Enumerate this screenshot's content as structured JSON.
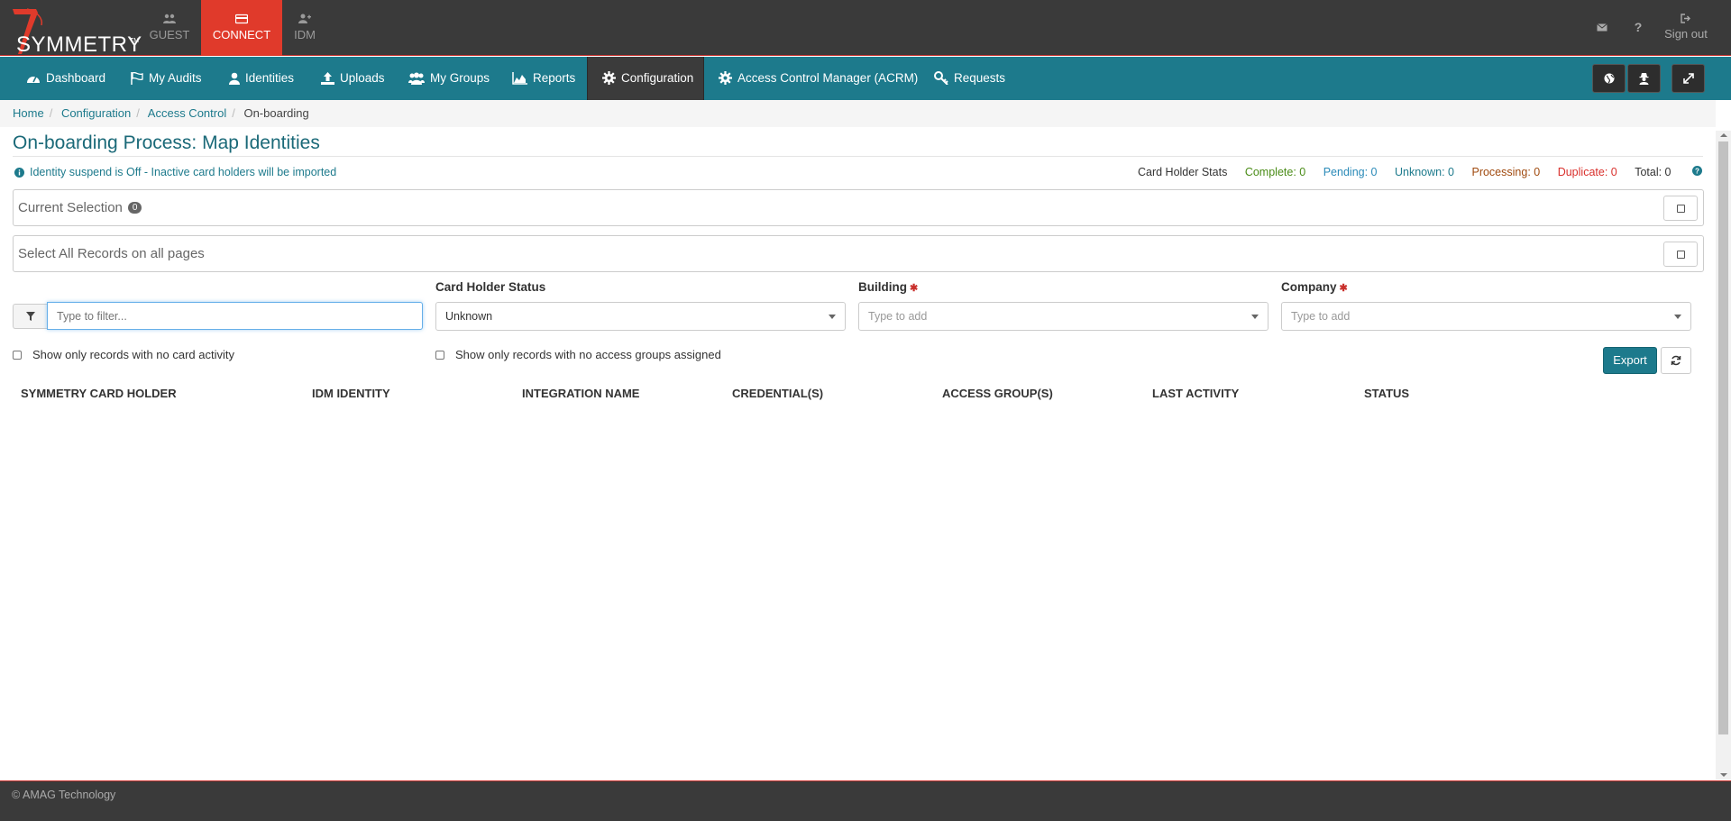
{
  "header": {
    "logo_text": "SYMMETRY",
    "logo_tm": "TM",
    "app_tabs": [
      {
        "label": "GUEST",
        "icon": "users-icon"
      },
      {
        "label": "CONNECT",
        "icon": "card-icon",
        "active": true
      },
      {
        "label": "IDM",
        "icon": "user-add-icon"
      }
    ],
    "right": {
      "mail_icon": "envelope-icon",
      "help_icon": "question-icon",
      "signout_label": "Sign out"
    },
    "colors": {
      "bar": "#3a3a3a",
      "active_tab": "#e03a2b",
      "accent": "#1d7a8c"
    }
  },
  "nav": {
    "items": [
      {
        "label": "Dashboard",
        "icon": "dashboard-icon"
      },
      {
        "label": "My Audits",
        "icon": "flag-icon"
      },
      {
        "label": "Identities",
        "icon": "user-icon"
      },
      {
        "label": "Uploads",
        "icon": "upload-icon"
      },
      {
        "label": "My Groups",
        "icon": "group-icon"
      },
      {
        "label": "Reports",
        "icon": "area-chart-icon"
      },
      {
        "label": "Configuration",
        "icon": "gear-icon",
        "active": true
      },
      {
        "label": "Access Control Manager (ACRM)",
        "icon": "gear-icon"
      },
      {
        "label": "Requests",
        "icon": "key-icon"
      }
    ],
    "right_buttons": [
      "globe-icon",
      "user-secret-icon",
      "expand-icon"
    ]
  },
  "breadcrumb": {
    "items": [
      "Home",
      "Configuration",
      "Access Control"
    ],
    "current": "On-boarding"
  },
  "page": {
    "title": "On-boarding Process: Map Identities",
    "info": "Identity suspend is Off - Inactive card holders will be imported",
    "stats": {
      "label": "Card Holder Stats",
      "complete": "Complete: 0",
      "pending": "Pending: 0",
      "unknown": "Unknown: 0",
      "processing": "Processing: 0",
      "duplicate": "Duplicate: 0",
      "total": "Total: 0"
    },
    "current_selection": {
      "label": "Current Selection",
      "count": "0"
    },
    "select_all": {
      "label": "Select All Records on all pages"
    }
  },
  "filters": {
    "filter_placeholder": "Type to filter...",
    "card_holder_status": {
      "label": "Card Holder Status",
      "value": "Unknown"
    },
    "building": {
      "label": "Building",
      "placeholder": "Type to add",
      "required": true
    },
    "company": {
      "label": "Company",
      "placeholder": "Type to add",
      "required": true
    },
    "no_card_activity": "Show only records with no card activity",
    "no_access_groups": "Show only records with no access groups assigned",
    "export_label": "Export"
  },
  "table": {
    "columns": [
      "SYMMETRY CARD HOLDER",
      "IDM IDENTITY",
      "INTEGRATION NAME",
      "CREDENTIAL(S)",
      "ACCESS GROUP(S)",
      "LAST ACTIVITY",
      "STATUS"
    ],
    "rows": []
  },
  "footer": {
    "text": "© AMAG Technology"
  }
}
